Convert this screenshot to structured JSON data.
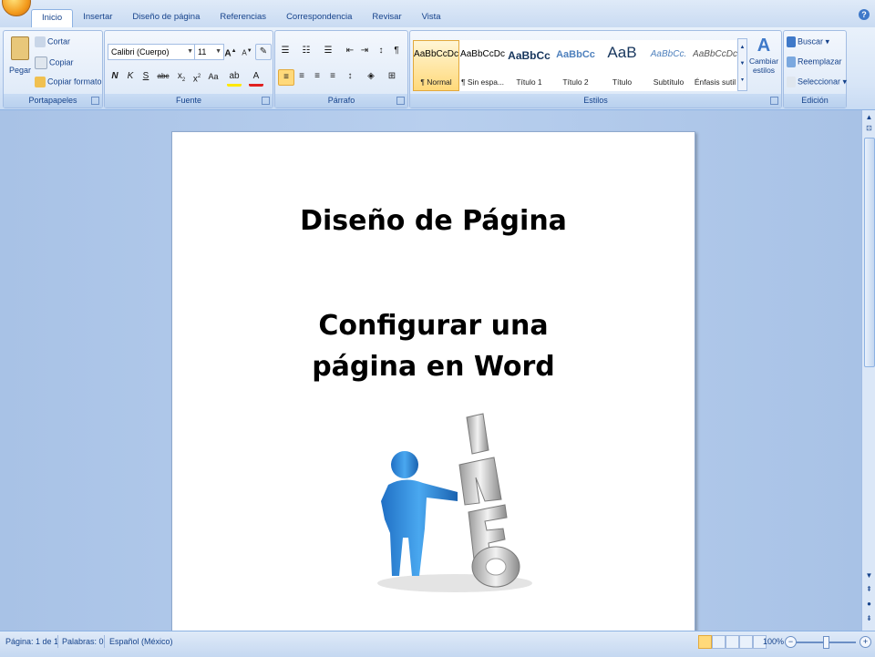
{
  "tabs": [
    "Inicio",
    "Insertar",
    "Diseño de página",
    "Referencias",
    "Correspondencia",
    "Revisar",
    "Vista"
  ],
  "clipboard": {
    "paste": "Pegar",
    "cut": "Cortar",
    "copy": "Copiar",
    "format_painter": "Copiar formato",
    "group": "Portapapeles"
  },
  "font": {
    "name": "Calibri (Cuerpo)",
    "size": "11",
    "group": "Fuente"
  },
  "paragraph": {
    "group": "Párrafo"
  },
  "styles": {
    "group": "Estilos",
    "items": [
      {
        "sample": "AaBbCcDc",
        "name": "¶ Normal"
      },
      {
        "sample": "AaBbCcDc",
        "name": "¶ Sin espa..."
      },
      {
        "sample": "AaBbCc",
        "name": "Título 1"
      },
      {
        "sample": "AaBbCc",
        "name": "Título 2"
      },
      {
        "sample": "AaB",
        "name": "Título"
      },
      {
        "sample": "AaBbCc.",
        "name": "Subtítulo"
      },
      {
        "sample": "AaBbCcDc",
        "name": "Énfasis sutil"
      }
    ],
    "change": "Cambiar estilos"
  },
  "editing": {
    "find": "Buscar",
    "replace": "Reemplazar",
    "select": "Seleccionar",
    "group": "Edición"
  },
  "document": {
    "title": "Diseño de Página",
    "subtitle_line1": "Configurar una",
    "subtitle_line2": "página en Word",
    "illustration_text": "INFO"
  },
  "status": {
    "page": "Página: 1 de 1",
    "words": "Palabras: 0",
    "language": "Español (México)",
    "zoom": "100%"
  },
  "colors": {
    "ribbon_text": "#15428b",
    "highlight": "#ffd97a",
    "figure_blue": "#2f8ee0"
  }
}
